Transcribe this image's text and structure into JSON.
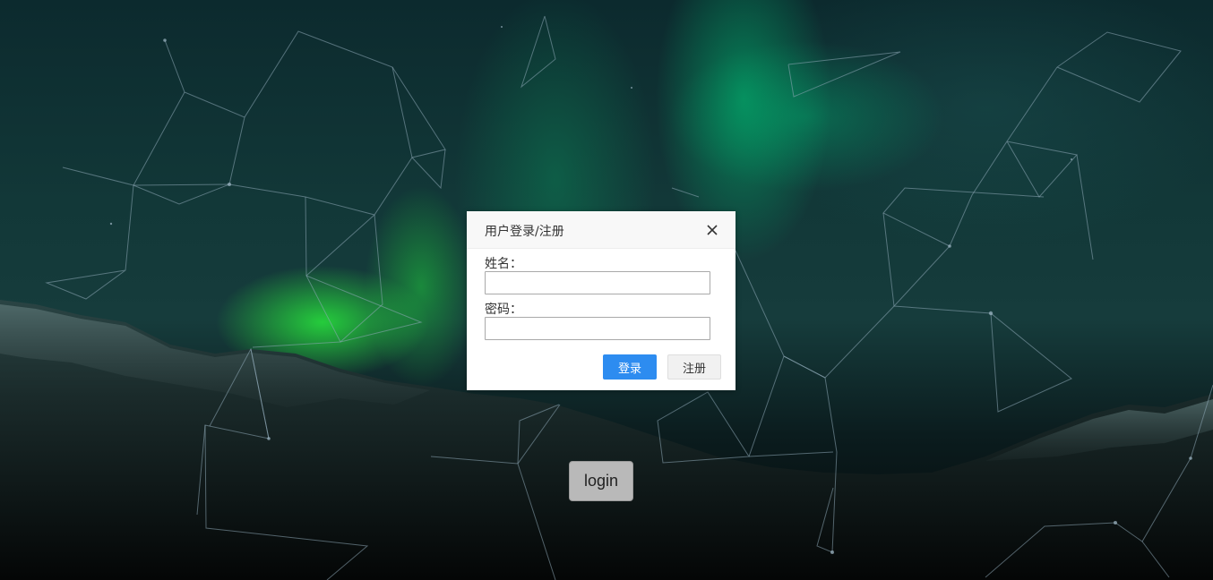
{
  "page": {
    "trigger_button_label": "login"
  },
  "dialog": {
    "title": "用户登录/注册",
    "name_label": "姓名：",
    "name_value": "",
    "password_label": "密码：",
    "password_value": "",
    "login_button_label": "登录",
    "register_button_label": "注册",
    "close_icon": "close-icon"
  },
  "colors": {
    "primary_button": "#2d8cf0",
    "secondary_button": "#f1f1f1",
    "network_lines": "#8fa9b8"
  }
}
